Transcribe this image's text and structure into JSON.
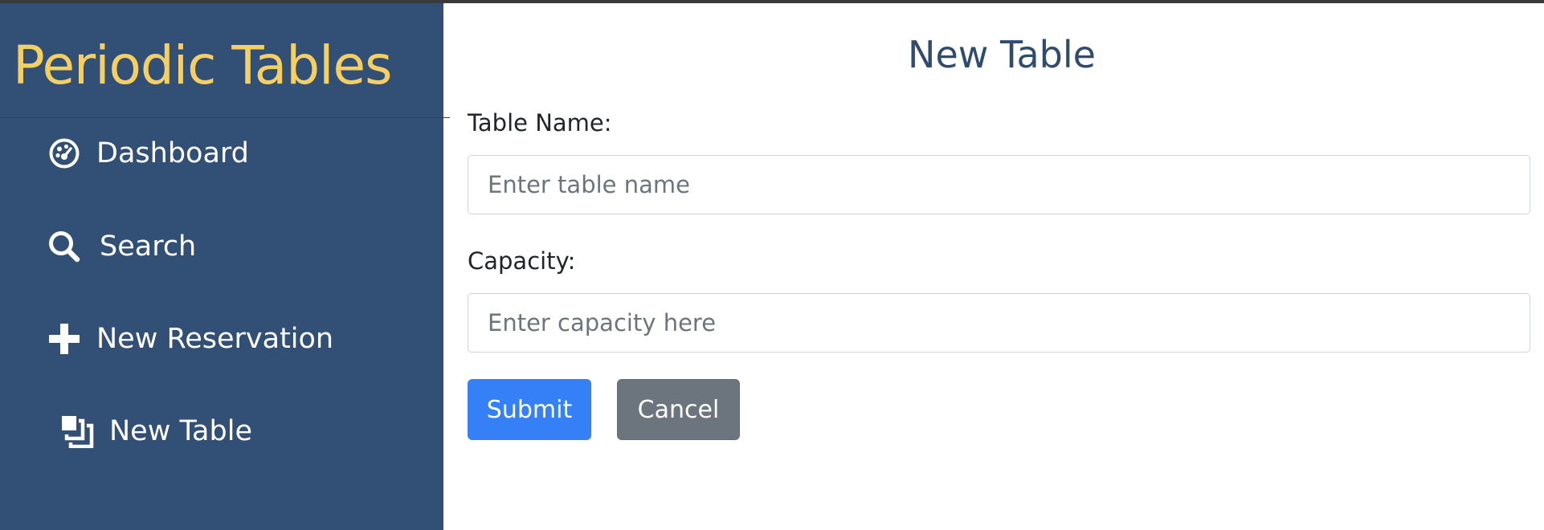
{
  "app": {
    "title": "Periodic Tables"
  },
  "sidebar": {
    "items": [
      {
        "label": "Dashboard",
        "icon": "dashboard-icon"
      },
      {
        "label": "Search",
        "icon": "search-icon"
      },
      {
        "label": "New Reservation",
        "icon": "plus-icon"
      },
      {
        "label": "New Table",
        "icon": "layers-icon"
      }
    ]
  },
  "main": {
    "title": "New Table",
    "form": {
      "table_name_label": "Table Name:",
      "table_name_placeholder": "Enter table name",
      "table_name_value": "",
      "capacity_label": "Capacity:",
      "capacity_placeholder": "Enter capacity here",
      "capacity_value": "",
      "submit_label": "Submit",
      "cancel_label": "Cancel"
    }
  },
  "colors": {
    "sidebar_bg": "#324f75",
    "brand": "#f6cf62",
    "title": "#2f4b70",
    "primary": "#3580f6",
    "secondary": "#6c757d"
  }
}
